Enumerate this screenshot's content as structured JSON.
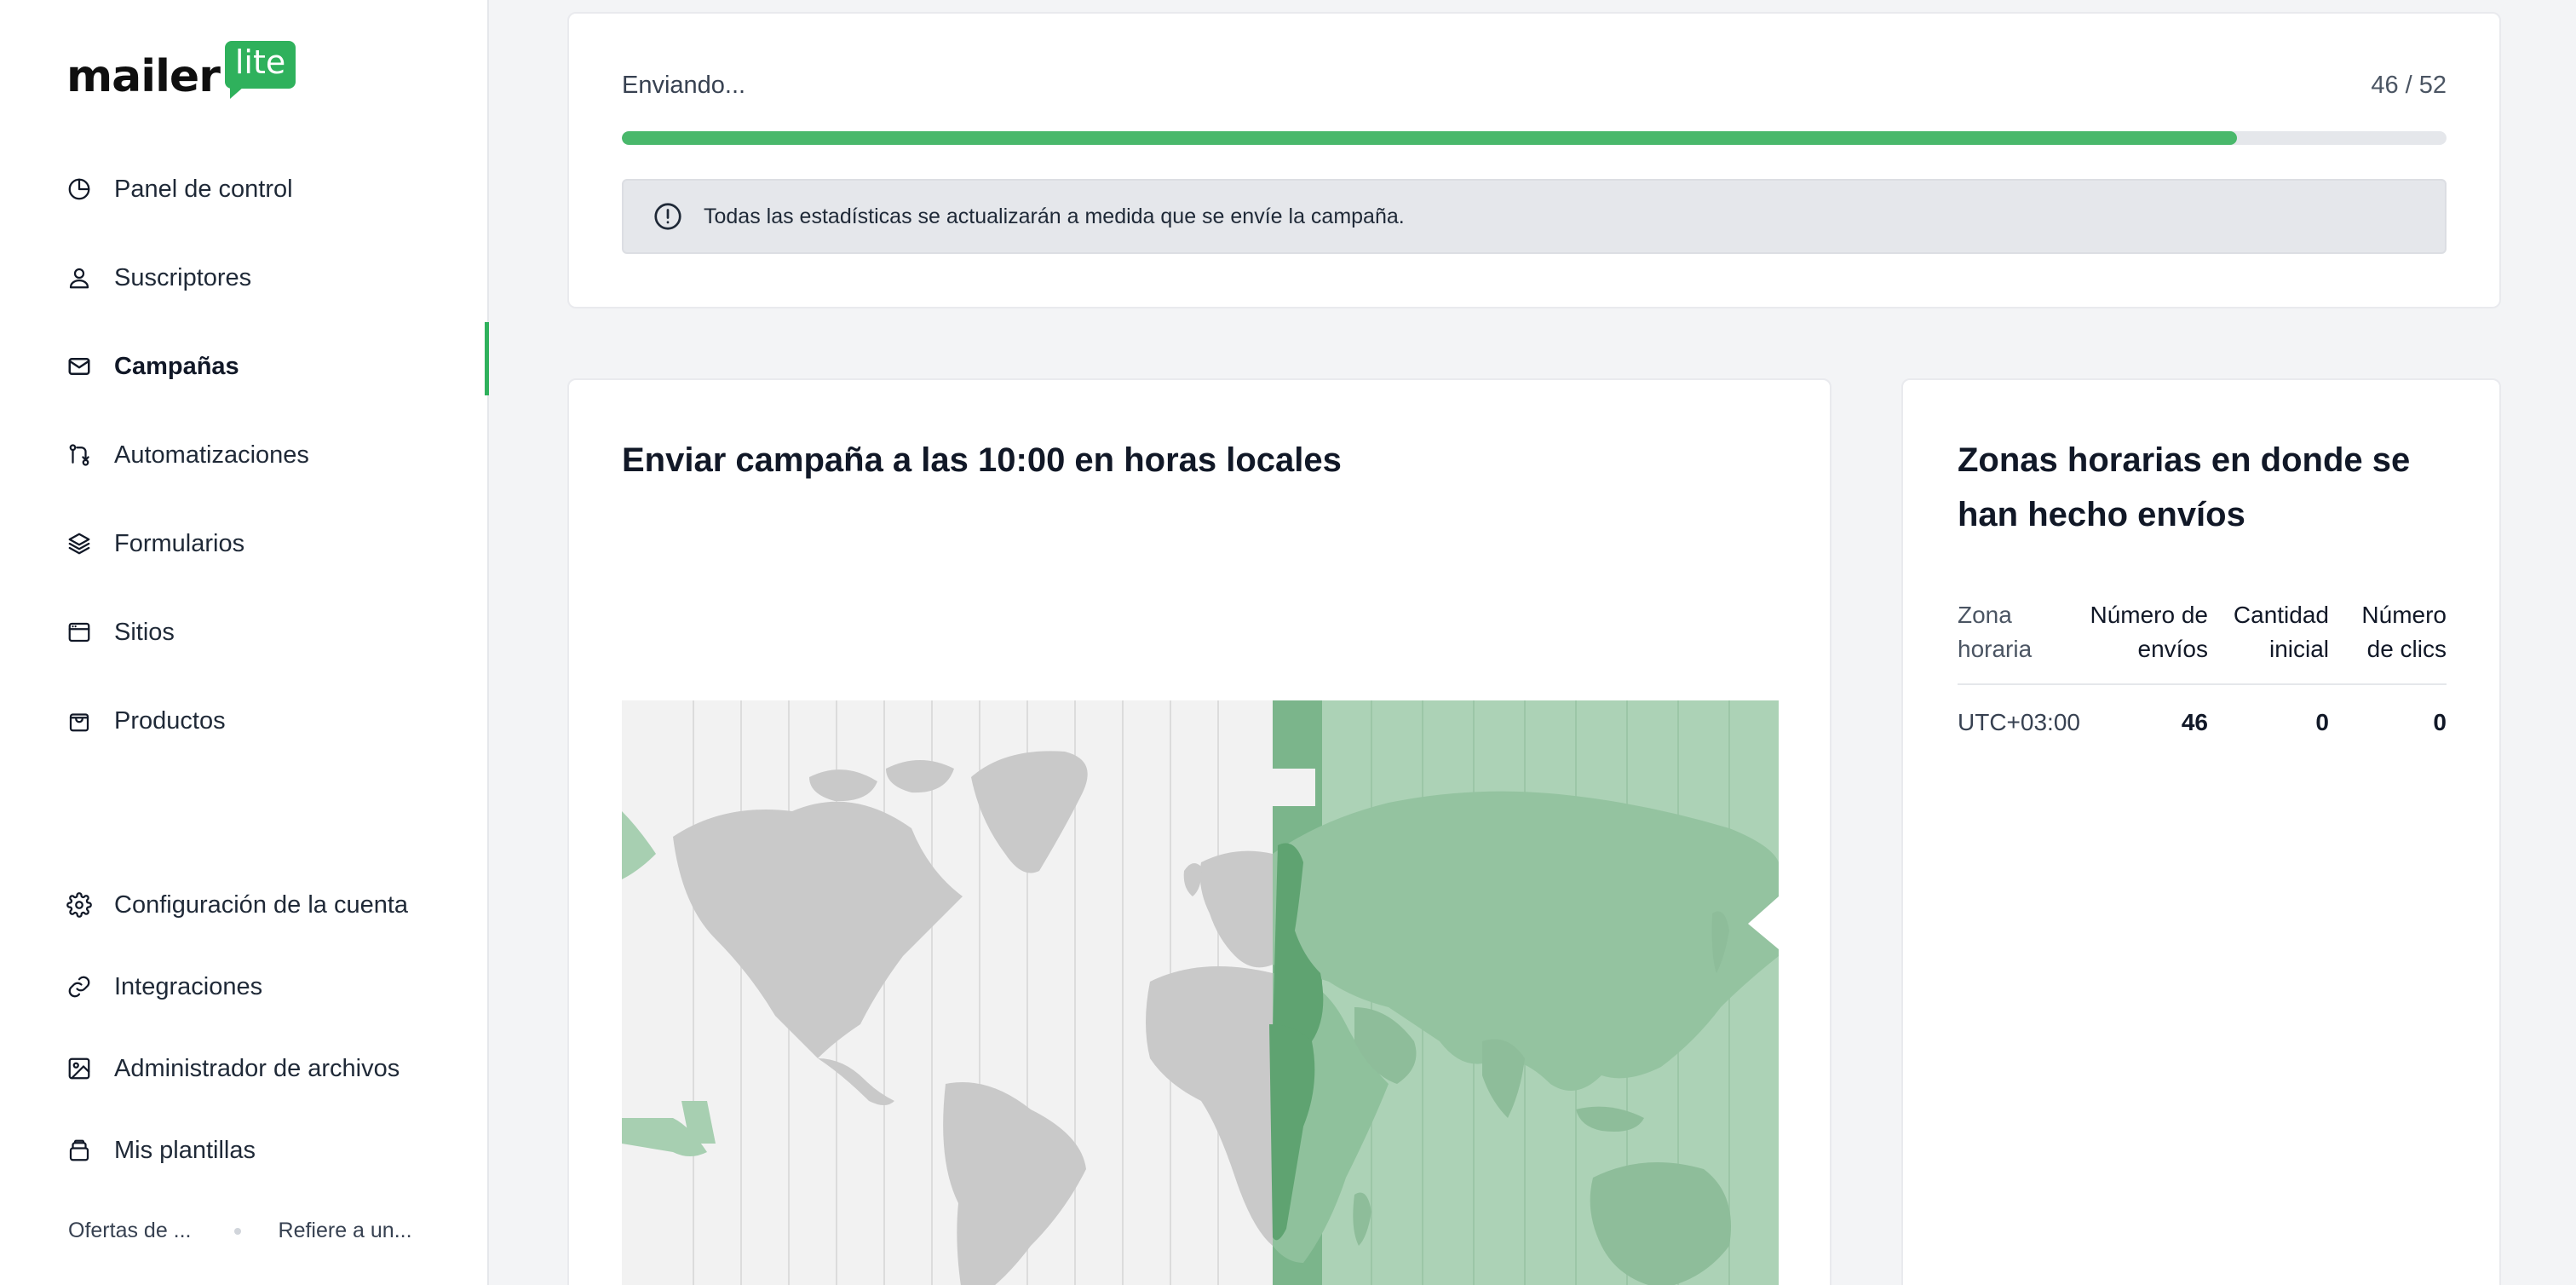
{
  "brand": {
    "name": "mailer",
    "badge": "lite",
    "accent": "#2fb15c"
  },
  "sidebar": {
    "items": [
      {
        "label": "Panel de control",
        "icon": "chart-pie-icon",
        "active": false
      },
      {
        "label": "Suscriptores",
        "icon": "user-icon",
        "active": false
      },
      {
        "label": "Campañas",
        "icon": "mail-icon",
        "active": true
      },
      {
        "label": "Automatizaciones",
        "icon": "workflow-icon",
        "active": false
      },
      {
        "label": "Formularios",
        "icon": "layers-icon",
        "active": false
      },
      {
        "label": "Sitios",
        "icon": "browser-icon",
        "active": false
      },
      {
        "label": "Productos",
        "icon": "shopping-bag-icon",
        "active": false
      }
    ],
    "bottom_items": [
      {
        "label": "Configuración de la cuenta",
        "icon": "gear-icon"
      },
      {
        "label": "Integraciones",
        "icon": "link-icon"
      },
      {
        "label": "Administrador de archivos",
        "icon": "image-icon"
      },
      {
        "label": "Mis plantillas",
        "icon": "template-icon"
      }
    ],
    "footer": {
      "link1": "Ofertas de ...",
      "link2": "Refiere a un..."
    }
  },
  "progress": {
    "label": "Enviando...",
    "count": "46 / 52",
    "fraction": 0.885,
    "color": "#49b86b"
  },
  "notice": {
    "icon": "alert-circle-icon",
    "text": "Todas las estadísticas se actualizarán a medida que se envíe la campaña."
  },
  "map_card": {
    "title": "Enviar campaña a las 10:00 en horas locales"
  },
  "timezones": {
    "title": "Zonas horarias en donde se han hecho envíos",
    "headers": [
      "Zona horaria",
      "Número de envíos",
      "Cantidad inicial",
      "Número de clics"
    ],
    "rows": [
      {
        "zone": "UTC+03:00",
        "sent": "46",
        "initial": "0",
        "clicks": "0"
      }
    ]
  }
}
